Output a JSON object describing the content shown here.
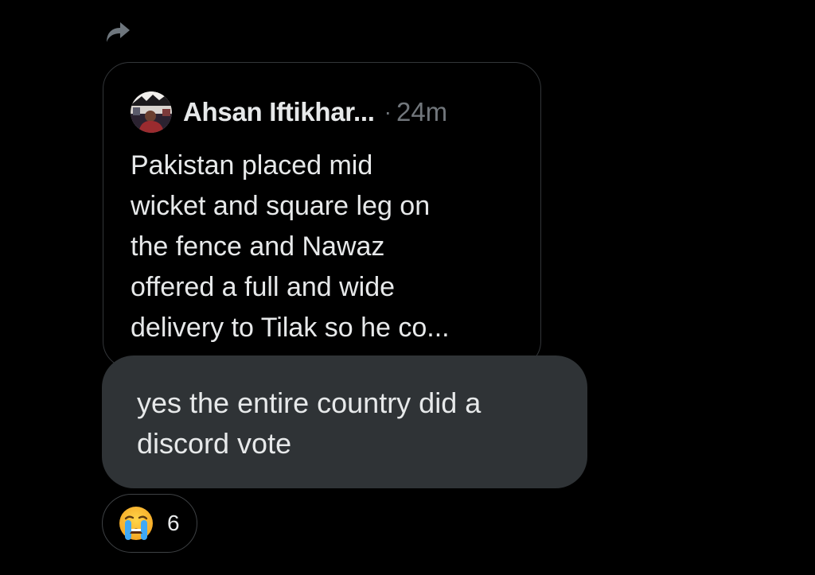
{
  "icons": {
    "share": "share-forward-icon",
    "reaction": "loudly-crying-face-icon"
  },
  "colors": {
    "background": "#000000",
    "card_border": "#333639",
    "bubble": "#2f3336",
    "text_primary": "#e7e9ea",
    "text_secondary": "#71767b"
  },
  "quoted_post": {
    "author_name": "Ahsan Iftikhar...",
    "separator": "·",
    "timestamp": "24m",
    "text": "Pakistan placed mid\nwicket and square leg on\nthe fence and Nawaz\noffered a full and wide\ndelivery to Tilak so he co..."
  },
  "message": {
    "text": "yes the entire country did a\ndiscord vote"
  },
  "reaction": {
    "emoji": "😭",
    "count": "6"
  }
}
